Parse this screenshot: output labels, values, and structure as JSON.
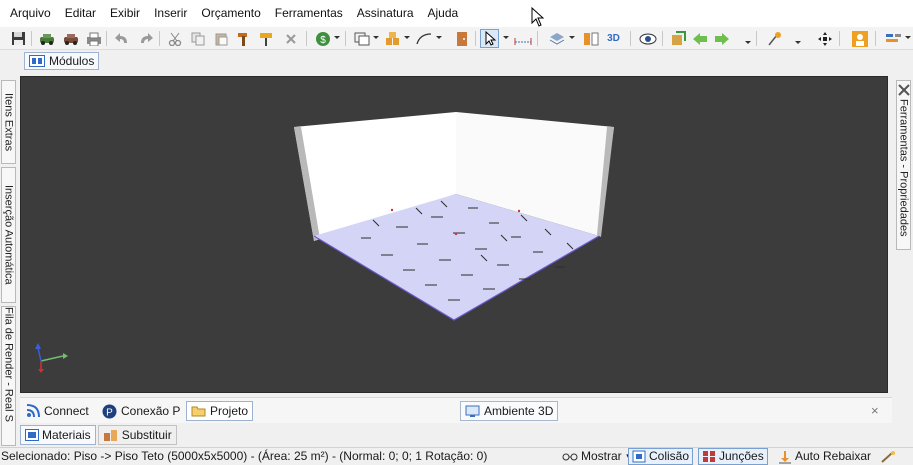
{
  "menu": {
    "items": [
      "Arquivo",
      "Editar",
      "Exibir",
      "Inserir",
      "Orçamento",
      "Ferramentas",
      "Assinatura",
      "Ajuda"
    ]
  },
  "toolbar": {
    "icons": [
      "save-icon",
      "car-icon",
      "car-icon",
      "print-icon",
      "undo-icon",
      "redo-icon",
      "cut-icon",
      "copy-icon",
      "paste-icon",
      "hammer-icon",
      "paint-roller-icon",
      "delete-icon",
      "money-icon",
      "layout-icon",
      "boxes-icon",
      "pen-icon",
      "door-icon",
      "pointer-icon",
      "dimension-icon",
      "layers-icon",
      "split-icon",
      "3d-icon",
      "eye-icon",
      "render-icon",
      "arrow-left-icon",
      "arrow-right-icon",
      "lamp-icon",
      "diamond-move-icon",
      "person-icon",
      "chart-icon"
    ],
    "label_3d": "3D"
  },
  "modules_tab": {
    "label": "Módulos"
  },
  "left_tabs": {
    "itens_extras": "Itens Extras",
    "insercao_automatica": "Inserção Automática",
    "fila_render": "Fila de Render - Real S"
  },
  "right_tab": {
    "label": "Ferramentas - Propriedades"
  },
  "panel_tabs": {
    "connect": "Connect",
    "conexao": "Conexão P",
    "projeto": "Projeto",
    "ambiente": "Ambiente 3D",
    "close": "×"
  },
  "material_tabs": {
    "materiais": "Materiais",
    "substituir": "Substituir"
  },
  "status": {
    "text": "Selecionado: Piso -> Piso Teto (5000x5x5000) - (Área: 25 m²) - (Normal: 0; 0; 1 Rotação: 0)",
    "mostrar": "Mostrar",
    "colisao": "Colisão",
    "juncoes": "Junções",
    "auto_rebaixar": "Auto Rebaixar"
  },
  "colors": {
    "viewport_bg": "#3c3c3c",
    "floor": "#d4d4f6",
    "wall": "#ffffff",
    "accent": "#2f7bd6"
  }
}
